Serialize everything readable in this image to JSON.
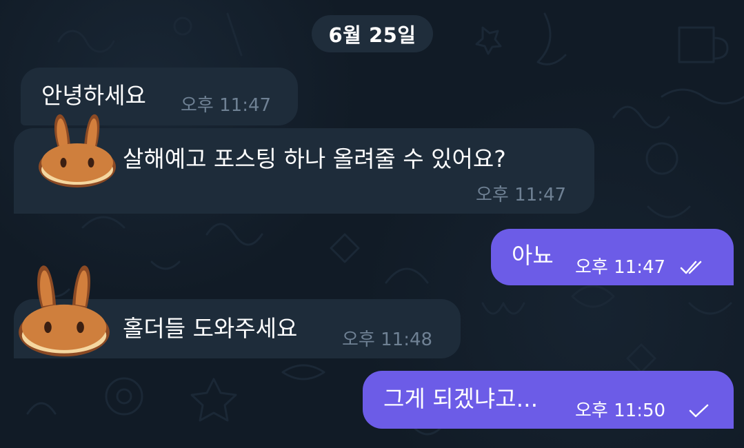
{
  "chat": {
    "date_separator": "6월 25일",
    "messages": [
      {
        "text": "안녕하세요",
        "time": "오후 11:47"
      },
      {
        "text": "살해예고  포스팅 하나 올려줄 수 있어요?",
        "time": "오후 11:47"
      },
      {
        "text": "아뇨",
        "time": "오후 11:47"
      },
      {
        "text": "홀더들 도와주세요",
        "time": "오후 11:48"
      },
      {
        "text": "그게 되겠냐고...",
        "time": "오후 11:50"
      }
    ]
  }
}
